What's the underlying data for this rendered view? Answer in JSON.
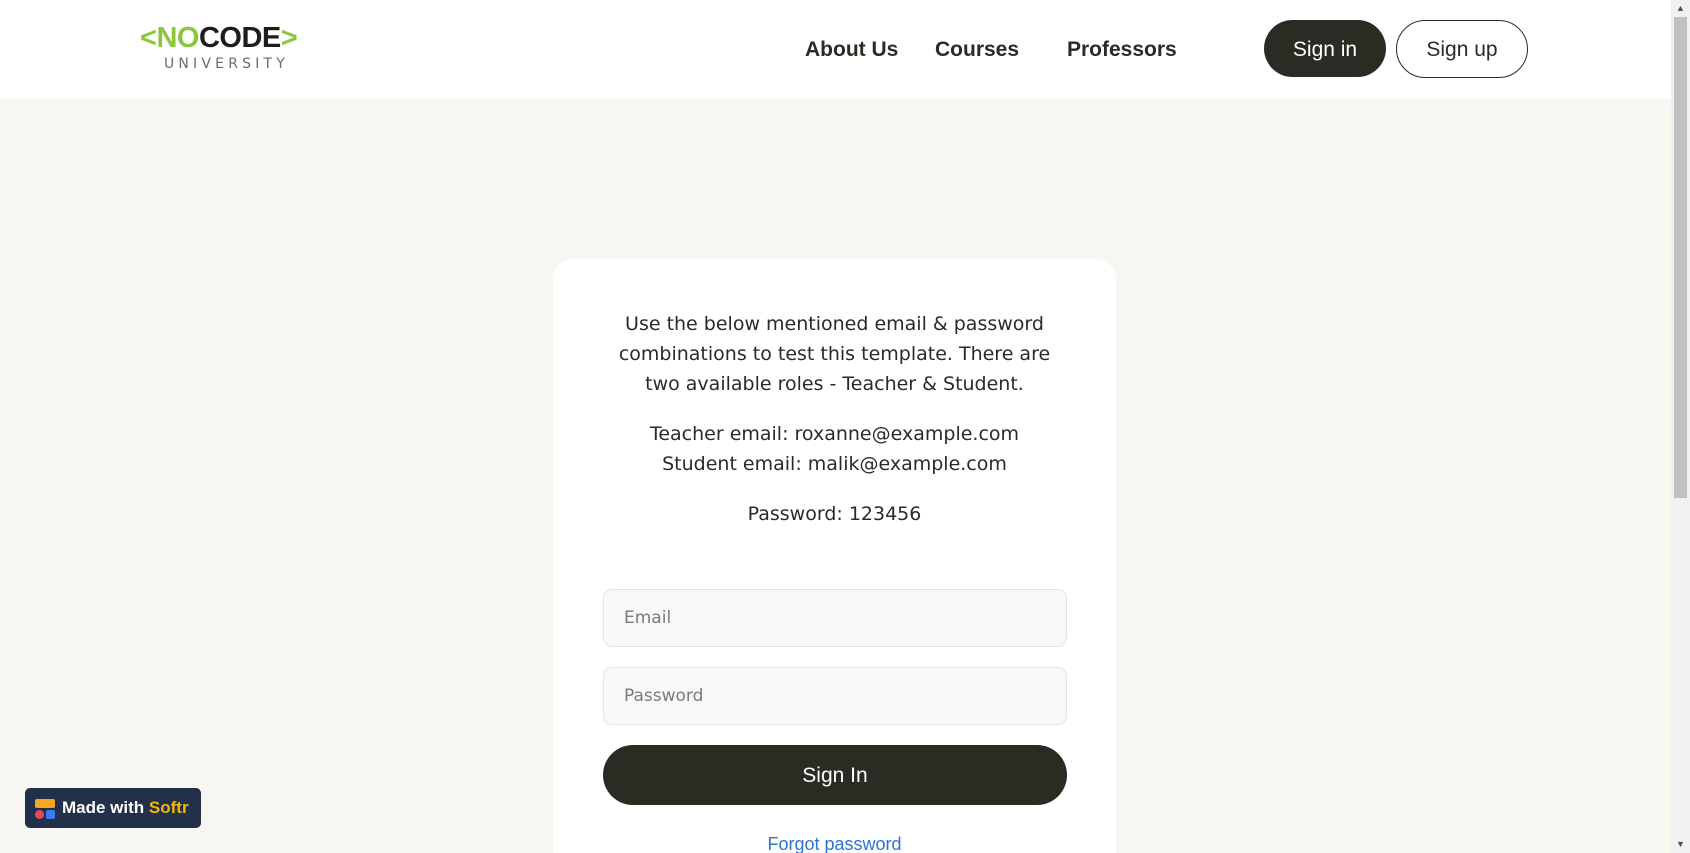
{
  "header": {
    "logo": {
      "bracket_open": "<",
      "word_no": "NO",
      "word_code": "CODE",
      "bracket_close": ">",
      "subtitle": "UNIVERSITY"
    },
    "nav": [
      {
        "label": "About Us"
      },
      {
        "label": "Courses"
      },
      {
        "label": "Professors"
      }
    ],
    "sign_in_label": "Sign in",
    "sign_up_label": "Sign up"
  },
  "login_card": {
    "intro": "Use the below mentioned email & password combinations to test this template. There are two available roles - Teacher & Student.",
    "teacher_email": "Teacher email: roxanne@example.com",
    "student_email": "Student email: malik@example.com",
    "password_hint": "Password: 123456",
    "email_placeholder": "Email",
    "email_value": "",
    "password_placeholder": "Password",
    "password_value": "",
    "submit_label": "Sign In",
    "forgot_label": "Forgot password"
  },
  "badge": {
    "prefix": "Made with ",
    "brand": "Softr",
    "icon": "softr-logo-icon"
  },
  "colors": {
    "brand_dark": "#2b2a23",
    "logo_green": "#8cc63f",
    "page_background": "#f8f6f0",
    "link_blue": "#2a74d4",
    "badge_background": "#22304a",
    "badge_brand": "#f5b700"
  }
}
